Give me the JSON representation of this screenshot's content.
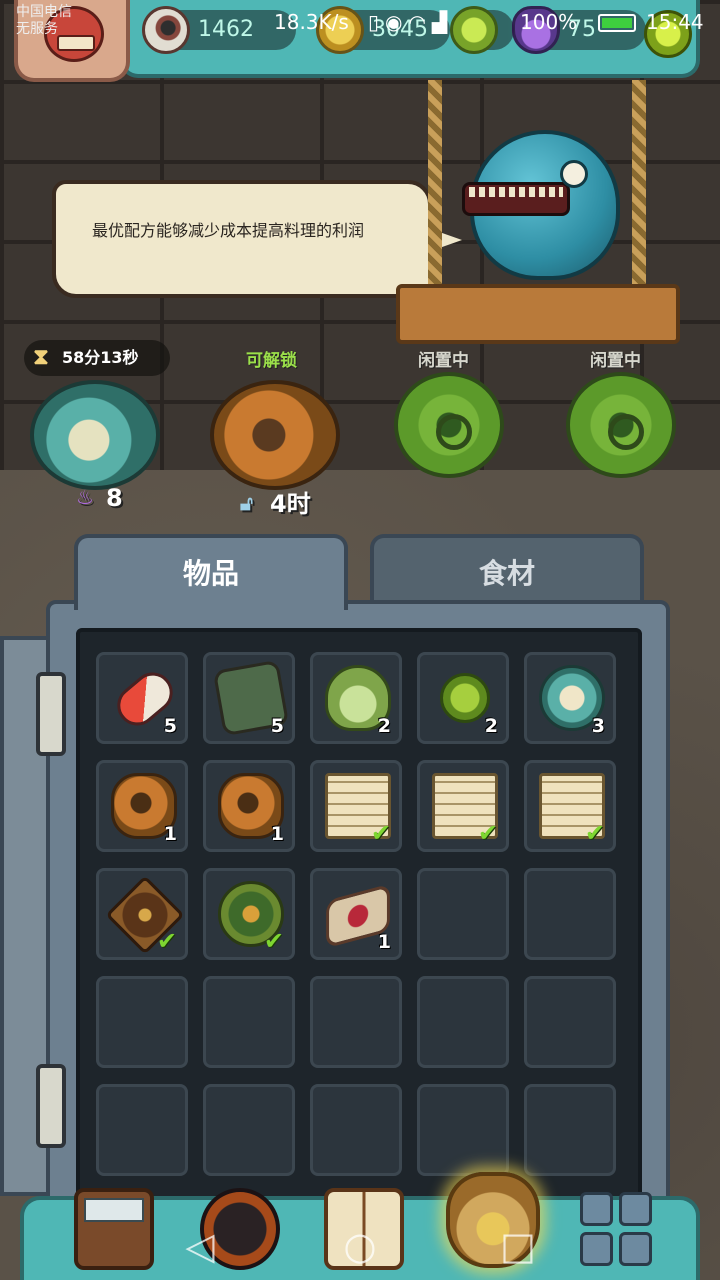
{
  "statusbar": {
    "carrier_line1": "中国电信",
    "carrier_line2": "无服务",
    "net_speed": "18.3K/s",
    "battery_pct": "100%",
    "time": "15:44"
  },
  "resources": {
    "eyeball": {
      "icon": "eyeball-icon",
      "value": "1462"
    },
    "gold": {
      "icon": "coin-icon",
      "value": "3045"
    },
    "gem": {
      "icon": "green-gem-icon",
      "value": ""
    },
    "potion": {
      "icon": "potion-icon",
      "value": "75"
    }
  },
  "dialog": {
    "text": "最优配方能够减少成本提高料理的利润"
  },
  "stations": [
    {
      "label": "58分13秒",
      "type": "timer",
      "stat": "8",
      "stat_icon": "potion-icon"
    },
    {
      "label": "可解锁",
      "type": "unlockable",
      "stat": "4时",
      "stat_icon": "lock-icon"
    },
    {
      "label": "闲置中",
      "type": "idle"
    },
    {
      "label": "闲置中",
      "type": "idle"
    }
  ],
  "tabs": {
    "items": "物品",
    "ingredients": "食材",
    "active": "物品"
  },
  "inventory": [
    {
      "icon": "capsule-icon",
      "qty": "5",
      "done": false
    },
    {
      "icon": "map-icon",
      "qty": "5",
      "done": false
    },
    {
      "icon": "egg-plant-icon",
      "qty": "2",
      "done": false
    },
    {
      "icon": "leaf-sprout-icon",
      "qty": "2",
      "done": false
    },
    {
      "icon": "shell-creature-icon",
      "qty": "3",
      "done": false
    },
    {
      "icon": "stump-creature-icon",
      "qty": "1",
      "done": false
    },
    {
      "icon": "stump-creature-icon",
      "qty": "1",
      "done": false
    },
    {
      "icon": "recipe-scroll-icon",
      "qty": "",
      "done": true
    },
    {
      "icon": "recipe-scroll-icon",
      "qty": "",
      "done": true
    },
    {
      "icon": "recipe-scroll-icon",
      "qty": "",
      "done": true
    },
    {
      "icon": "tree-plate-icon",
      "qty": "",
      "done": true
    },
    {
      "icon": "vine-plate-icon",
      "qty": "",
      "done": true
    },
    {
      "icon": "cloth-map-icon",
      "qty": "1",
      "done": false
    }
  ],
  "colors": {
    "accent_teal": "#4fb7b5",
    "panel": "#6d8090",
    "check_green": "#7ed631",
    "unlock_green": "#9be04a"
  }
}
